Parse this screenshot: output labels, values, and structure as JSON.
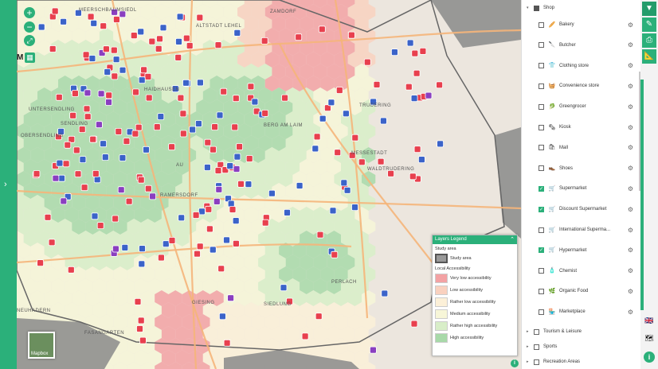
{
  "map": {
    "zoom_in": "+",
    "zoom_out": "−",
    "fullscreen": "⤢",
    "layers_letter": "M",
    "labels": [
      "MEERSCHBAUMSIEDL",
      "ALTSTADT LEHEL",
      "ZAMDORF",
      "HAIDHAUSEN",
      "AU",
      "RAMERSDORF",
      "BERG AM LAIM",
      "TRUDERING",
      "NEUHADERN",
      "FASANGARTEN",
      "PERLACH",
      "OBERSENDLING",
      "UNTERSENDLING",
      "SENDLING",
      "MESSESTADT",
      "WALDTRUDERING",
      "SIEDLUNG",
      "GIESING"
    ],
    "basemap_label": "Mapbox"
  },
  "legend": {
    "title": "Layers Legend",
    "toggle": "⌃",
    "study_section": "Study area",
    "study_label": "Study area",
    "access_section": "Local Accessibility",
    "items": [
      {
        "label": "Very low accessibility",
        "color": "#f3a2a4"
      },
      {
        "label": "Low accessibility",
        "color": "#f9d1bf"
      },
      {
        "label": "Rather low accessibility",
        "color": "#fcf0d8"
      },
      {
        "label": "Medium accessibility",
        "color": "#f7f6d8"
      },
      {
        "label": "Rather high accessibility",
        "color": "#d8eec8"
      },
      {
        "label": "High accessibility",
        "color": "#a8d9a9"
      }
    ]
  },
  "panel": {
    "group_shop": "Shop",
    "items": [
      {
        "label": "Bakery",
        "icon": "🥖",
        "checked": false
      },
      {
        "label": "Butcher",
        "icon": "🔪",
        "checked": false
      },
      {
        "label": "Clothing store",
        "icon": "👕",
        "checked": false
      },
      {
        "label": "Convenience store",
        "icon": "🧺",
        "checked": false
      },
      {
        "label": "Greengrocer",
        "icon": "🥬",
        "checked": false
      },
      {
        "label": "Kiosk",
        "icon": "🗞",
        "checked": false
      },
      {
        "label": "Mall",
        "icon": "🛍",
        "checked": false
      },
      {
        "label": "Shoes",
        "icon": "👞",
        "checked": false
      },
      {
        "label": "Supermarket",
        "icon": "🛒",
        "checked": true
      },
      {
        "label": "Discount Supermarket",
        "icon": "🛒",
        "checked": true
      },
      {
        "label": "International Superma...",
        "icon": "🛒",
        "checked": false
      },
      {
        "label": "Hypermarket",
        "icon": "🛒",
        "checked": true
      },
      {
        "label": "Chemist",
        "icon": "🧴",
        "checked": false
      },
      {
        "label": "Organic Food",
        "icon": "🌿",
        "checked": false
      },
      {
        "label": "Marketplace",
        "icon": "🏪",
        "checked": false
      }
    ],
    "groups_after": [
      "Tourism & Leisure",
      "Sports",
      "Recreation Areas"
    ]
  },
  "toolbar": {
    "filter": "▼",
    "edit": "✎",
    "print": "⎙",
    "ruler": "📐",
    "flag": "🇬🇧",
    "map_icon": "🗺",
    "info": "i"
  },
  "info_btn": "i"
}
